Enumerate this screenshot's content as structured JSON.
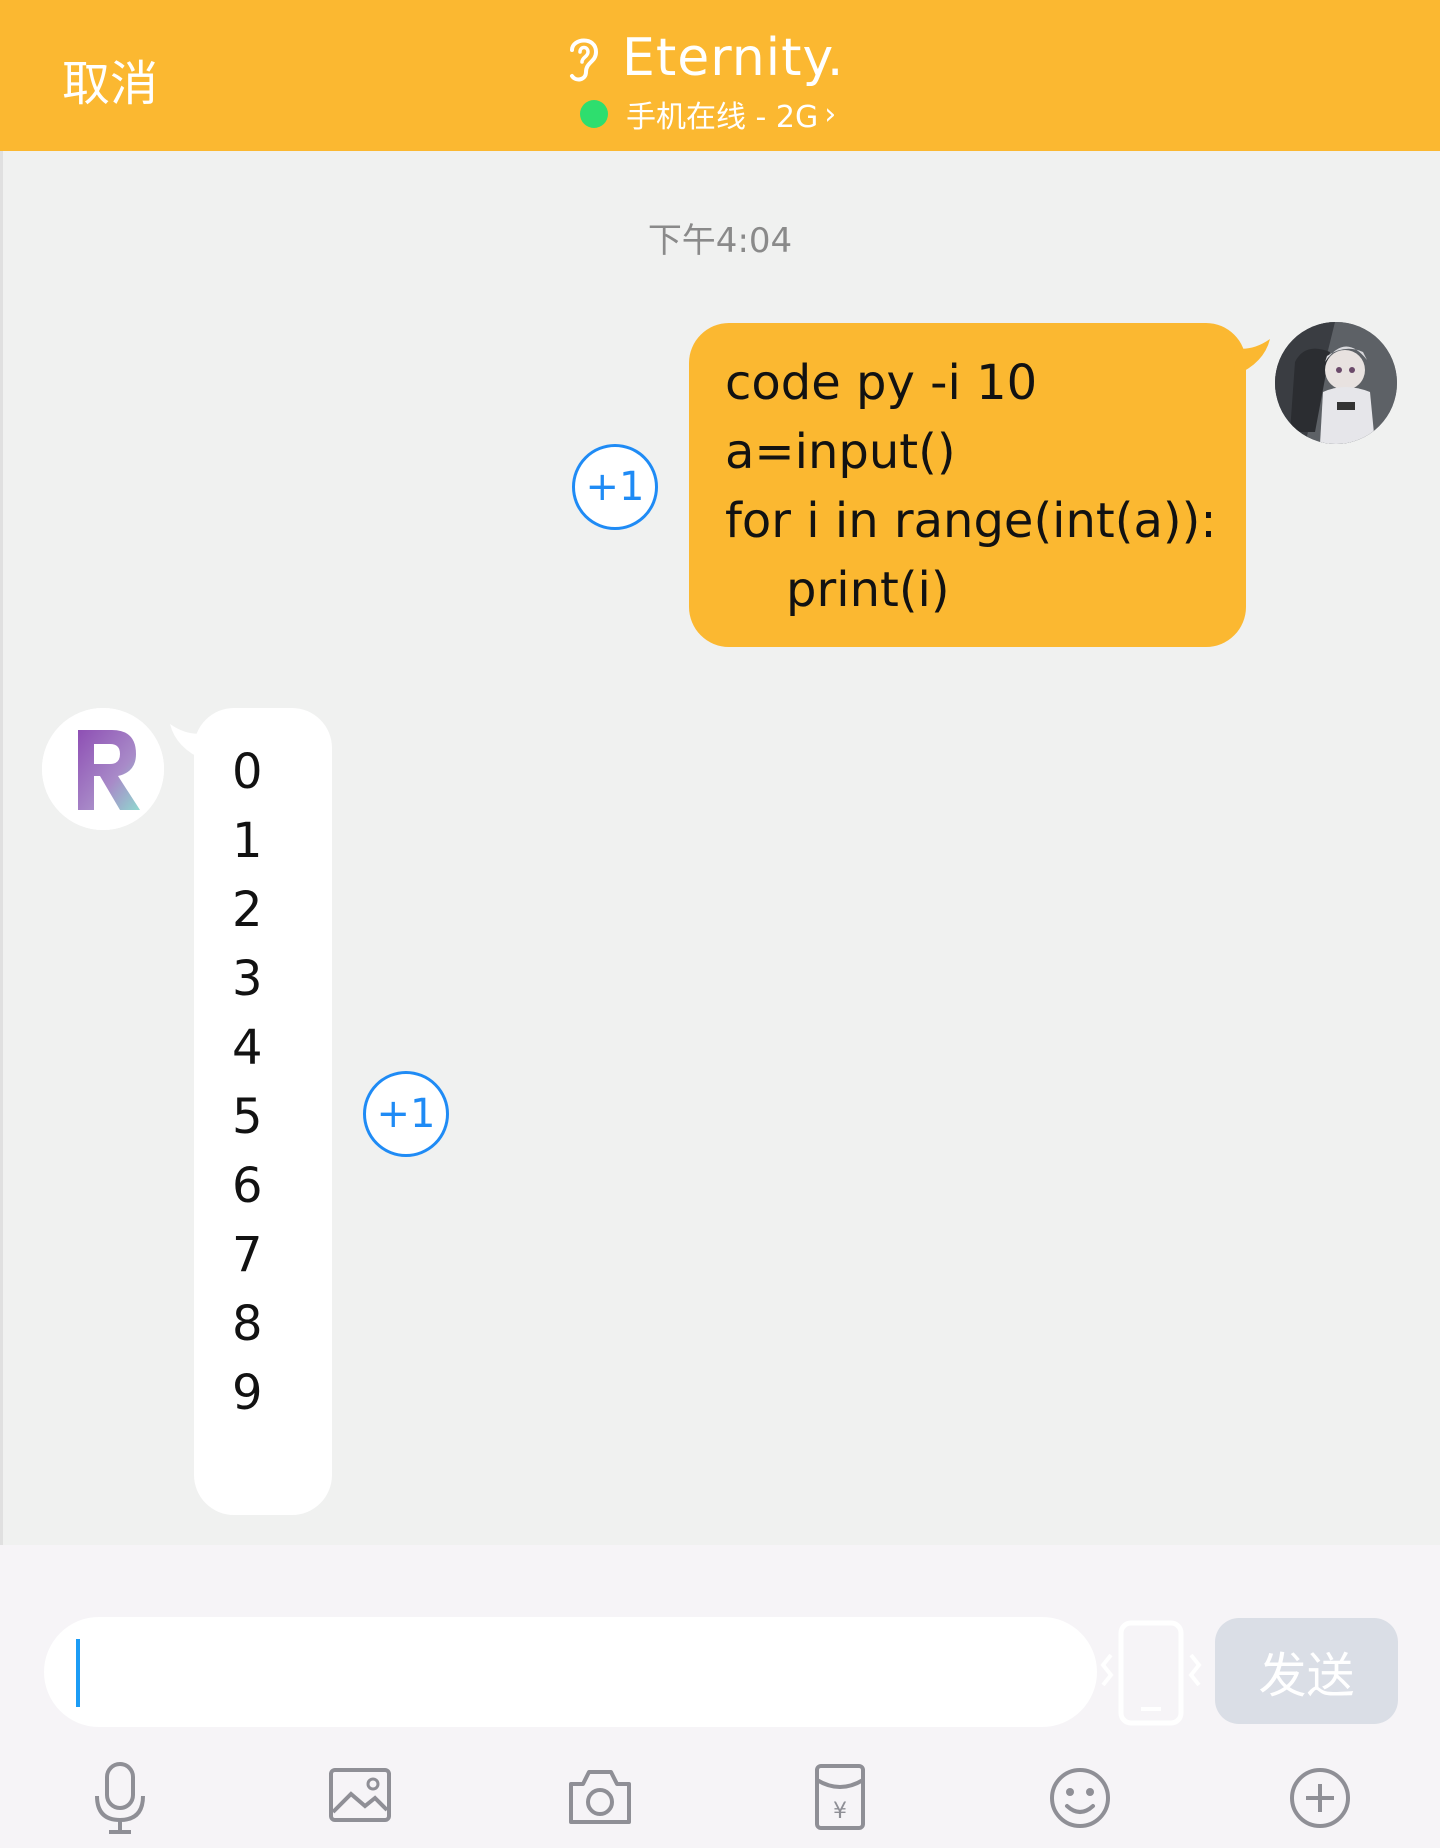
{
  "header": {
    "cancel_label": "取消",
    "title": "Eternity.",
    "status_text": "手机在线 - 2G",
    "status_chevron": "›",
    "icons": {
      "left": "ear-icon",
      "status": "online-dot-icon"
    }
  },
  "chat": {
    "timestamp": "下午4:04",
    "messages": [
      {
        "sender": "me",
        "lines": [
          "code py -i 10",
          "a=input()",
          "for i in range(int(a)):",
          "    print(i)"
        ],
        "plus_one": "+1"
      },
      {
        "sender": "bot",
        "avatar_letter": "R",
        "lines": [
          "0",
          "1",
          "2",
          "3",
          "4",
          "5",
          "6",
          "7",
          "8",
          "9"
        ],
        "plus_one": "+1"
      }
    ]
  },
  "input": {
    "value": "",
    "placeholder": "",
    "send_label": "发送"
  },
  "toolbar": {
    "items": [
      "microphone-icon",
      "image-icon",
      "camera-icon",
      "red-packet-icon",
      "emoji-icon",
      "plus-icon"
    ]
  },
  "colors": {
    "accent": "#fbb831",
    "online": "#2ede6e",
    "plus_one": "#1f8bf5",
    "send_disabled": "#dadee6"
  }
}
